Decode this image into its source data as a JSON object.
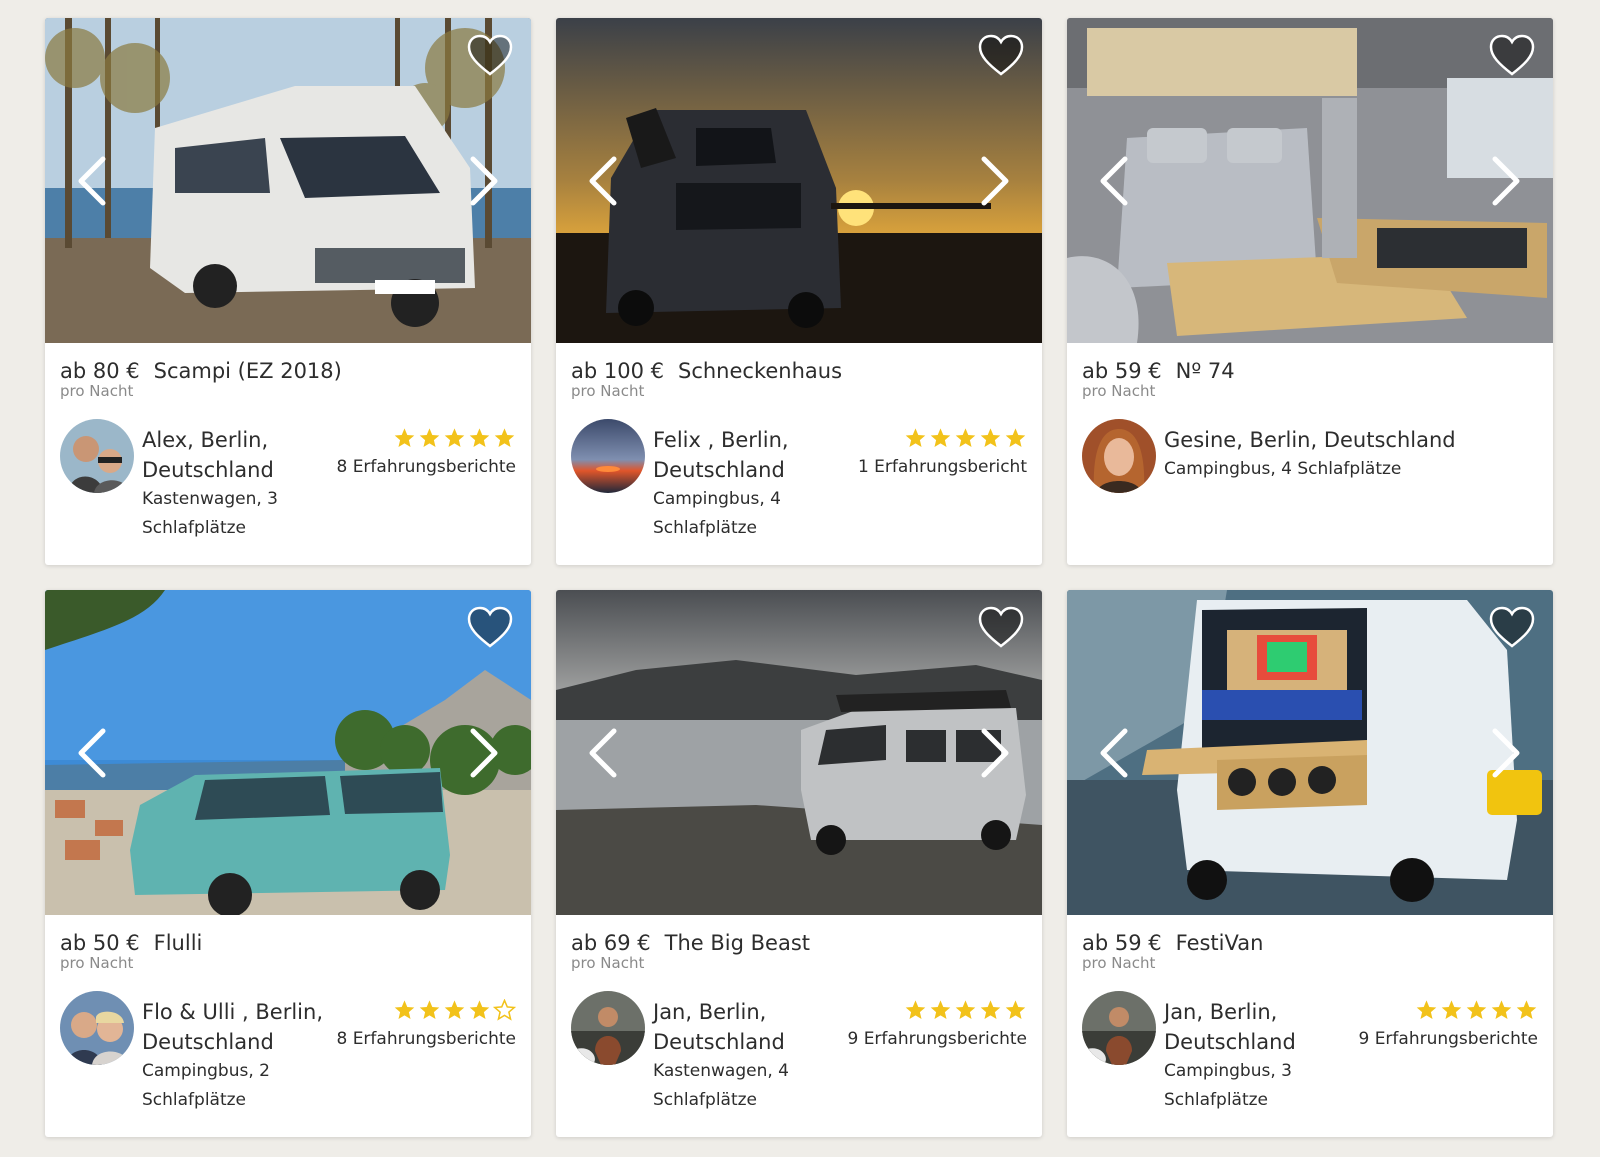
{
  "listings": [
    {
      "price": "ab 80 €",
      "title": "Scampi (EZ 2018)",
      "per_night": "pro Nacht",
      "owner": "Alex, Berlin, Deutschland",
      "vehicle": "Kastenwagen, 3 Schlafplätze",
      "stars": 5,
      "reviews": "8 Erfahrungsberichte"
    },
    {
      "price": "ab 100 €",
      "title": "Schneckenhaus",
      "per_night": "pro Nacht",
      "owner": "Felix , Berlin, Deutschland",
      "vehicle": "Campingbus, 4 Schlafplätze",
      "stars": 5,
      "reviews": "1 Erfahrungsbericht"
    },
    {
      "price": "ab 59 €",
      "title": "Nº 74",
      "per_night": "pro Nacht",
      "owner": "Gesine, Berlin, Deutschland",
      "vehicle": "Campingbus, 4 Schlafplätze",
      "stars": 0,
      "reviews": ""
    },
    {
      "price": "ab 50 €",
      "title": "Flulli",
      "per_night": "pro Nacht",
      "owner": "Flo & Ulli , Berlin, Deutschland",
      "vehicle": "Campingbus, 2 Schlafplätze",
      "stars": 4,
      "reviews": "8 Erfahrungsberichte"
    },
    {
      "price": "ab 69 €",
      "title": "The Big Beast",
      "per_night": "pro Nacht",
      "owner": "Jan, Berlin, Deutschland",
      "vehicle": "Kastenwagen, 4 Schlafplätze",
      "stars": 5,
      "reviews": "9 Erfahrungsberichte"
    },
    {
      "price": "ab 59 €",
      "title": "FestiVan",
      "per_night": "pro Nacht",
      "owner": "Jan, Berlin, Deutschland",
      "vehicle": "Campingbus, 3 Schlafplätze",
      "stars": 5,
      "reviews": "9 Erfahrungsberichte"
    }
  ],
  "colors": {
    "background": "#efede8",
    "star": "#f2c21a",
    "text": "#2d2d2d",
    "muted": "#8a8a8a"
  },
  "icons": {
    "favorite": "heart-icon",
    "previous": "chevron-left-icon",
    "next": "chevron-right-icon",
    "rating": "star-icon"
  }
}
